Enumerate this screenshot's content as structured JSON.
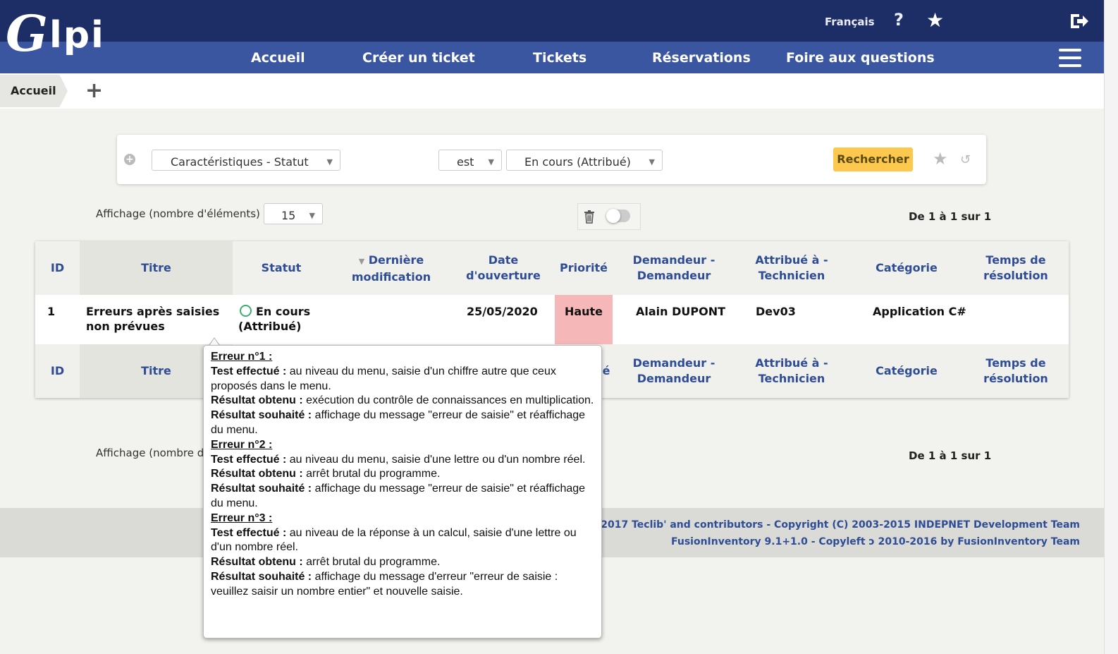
{
  "header": {
    "language": "Français",
    "help": "?",
    "nav": [
      "Accueil",
      "Créer un ticket",
      "Tickets",
      "Réservations",
      "Foire aux questions"
    ],
    "logo": "Glpi"
  },
  "breadcrumb": {
    "home": "Accueil",
    "add": "+"
  },
  "search": {
    "criteria_field": "Caractéristiques - Statut",
    "operator": "est",
    "value": "En cours (Attribué)",
    "button": "Rechercher"
  },
  "display": {
    "label": "Affichage (nombre d'éléments)",
    "count": "15",
    "label_bottom_partial": "Affichage (nombre d",
    "page_info": "De 1 à 1 sur 1"
  },
  "table": {
    "headers": [
      "ID",
      "Titre",
      "Statut",
      "Dernière modification",
      "Date d'ouverture",
      "Priorité",
      "Demandeur - Demandeur",
      "Attribué à - Technicien",
      "Catégorie",
      "Temps de résolution"
    ],
    "headers_display": {
      "id": "ID",
      "titre": "Titre",
      "statut": "Statut",
      "derniere_1": "Dernière",
      "derniere_2": "modification",
      "date_1": "Date",
      "date_2": "d'ouverture",
      "priorite": "Priorité",
      "demandeur_1": "Demandeur -",
      "demandeur_2": "Demandeur",
      "attribue_1": "Attribué à -",
      "attribue_2": "Technicien",
      "categorie": "Catégorie",
      "temps_1": "Temps de",
      "temps_2": "résolution",
      "priorite_partial": "é"
    },
    "row": {
      "id": "1",
      "titre_1": "Erreurs après saisies",
      "titre_2": "non prévues",
      "statut_1": "En cours",
      "statut_2": "(Attribué)",
      "date": "25/05/2020",
      "priorite": "Haute",
      "demandeur": "Alain DUPONT",
      "technicien": "Dev03",
      "categorie": "Application C#"
    }
  },
  "tooltip": [
    {
      "title": "Erreur n°1 :",
      "test_k": "Test effectué :",
      "test_v": " au niveau du menu, saisie d'un chiffre autre que ceux proposés dans le menu.",
      "obt_k": "Résultat obtenu :",
      "obt_v": " exécution du contrôle de connaissances en multiplication.",
      "sou_k": "Résultat souhaité :",
      "sou_v": " affichage du message \"erreur de saisie\" et réaffichage du menu."
    },
    {
      "title": "Erreur n°2 :",
      "test_k": "Test effectué :",
      "test_v": " au niveau du menu, saisie d'une lettre ou d'un nombre réel.",
      "obt_k": "Résultat obtenu :",
      "obt_v": " arrêt brutal du programme.",
      "sou_k": "Résultat souhaité :",
      "sou_v": " affichage du message \"erreur de saisie\" et réaffichage du menu."
    },
    {
      "title": "Erreur n°3 :",
      "test_k": "Test effectué :",
      "test_v": " au niveau de la réponse à un calcul, saisie d'une lettre ou d'un nombre réel.",
      "obt_k": "Résultat obtenu :",
      "obt_v": " arrêt brutal du programme.",
      "sou_k": "Résultat souhaité :",
      "sou_v": " affichage du message d'erreur \"erreur de saisie : veuillez saisir un nombre entier\" et nouvelle saisie."
    }
  ],
  "footer": {
    "line1": "2015-2017 Teclib' and contributors - Copyright (C) 2003-2015 INDEPNET Development Team",
    "line2_a": "FusionInventory 9.1+1.0 - Copyleft",
    "line2_b": "2010-2016 by FusionInventory Team"
  },
  "icons": {
    "help": "question-icon",
    "favorite": "star-icon",
    "logout": "logout-icon",
    "menu": "hamburger-icon",
    "trash": "trash-icon",
    "status": "circle-status-icon"
  },
  "colors": {
    "header": "#1d2d65",
    "nav": "#3a56a0",
    "search_button": "#fcc94e",
    "priority_high": "#f6b7b9",
    "status_ok": "#3fae6f"
  }
}
